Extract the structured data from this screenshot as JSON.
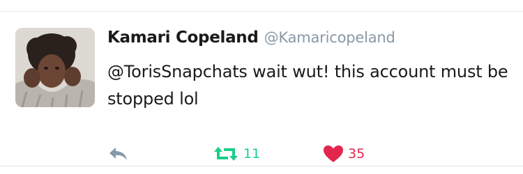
{
  "tweet": {
    "display_name": "Kamari Copeland",
    "handle": "@Kamaricopeland",
    "text": "@TorisSnapchats wait wut! this account must be stopped lol",
    "retweet_count": "11",
    "like_count": "35"
  },
  "icons": {
    "reply": "reply-icon",
    "retweet": "retweet-icon",
    "like": "heart-icon"
  },
  "colors": {
    "retweet": "#19cf86",
    "like": "#e2264d",
    "muted": "#8899a6"
  }
}
